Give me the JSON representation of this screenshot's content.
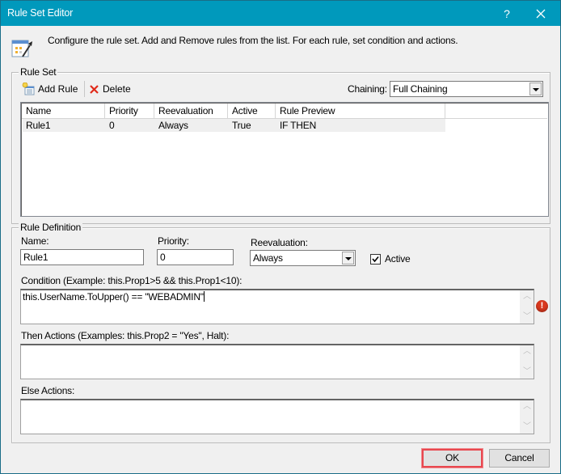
{
  "window": {
    "title": "Rule Set Editor",
    "help_label": "?",
    "close_label": "✕"
  },
  "header": {
    "icon": "rule-set-icon",
    "description": "Configure the rule set. Add and Remove rules from the list. For each rule, set condition and actions."
  },
  "rule_set": {
    "legend": "Rule Set",
    "add_rule_label": "Add Rule",
    "delete_label": "Delete",
    "chaining_label": "Chaining:",
    "chaining_value": "Full Chaining",
    "columns": [
      "Name",
      "Priority",
      "Reevaluation",
      "Active",
      "Rule Preview",
      ""
    ],
    "rows": [
      {
        "name": "Rule1",
        "priority": "0",
        "reevaluation": "Always",
        "active": "True",
        "preview": "IF THEN"
      }
    ]
  },
  "rule_definition": {
    "legend": "Rule Definition",
    "name_label": "Name:",
    "name_value": "Rule1",
    "priority_label": "Priority:",
    "priority_value": "0",
    "reevaluation_label": "Reevaluation:",
    "reevaluation_value": "Always",
    "active_label": "Active",
    "active_checked": true,
    "condition_label": "Condition (Example: this.Prop1>5 && this.Prop1<10):",
    "condition_value": "this.UserName.ToUpper() == \"WEBADMIN\"",
    "condition_error_icon": "error-icon",
    "then_label": "Then Actions (Examples: this.Prop2 = \"Yes\", Halt):",
    "then_value": "",
    "else_label": "Else Actions:",
    "else_value": ""
  },
  "footer": {
    "ok_label": "OK",
    "cancel_label": "Cancel",
    "highlight_color": "#e8474f"
  },
  "colors": {
    "titlebar": "#0099bc",
    "background": "#f0f0f0"
  }
}
